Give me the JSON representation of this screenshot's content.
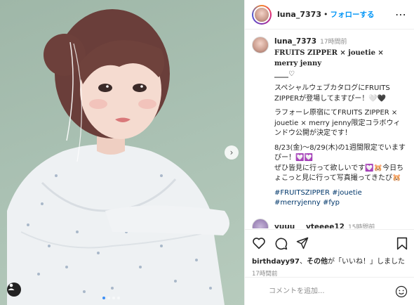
{
  "header": {
    "username": "luna_7373",
    "separator": "•",
    "follow_label": "フォローする",
    "more_label": "⋯"
  },
  "caption": {
    "username": "luna_7373",
    "time": "17時間前",
    "title": "FRUITS ZIPPER × jouetie × merry jenny",
    "title_tail": "____♡",
    "para1": "スペシャルウェブカタログにFRUITS ZIPPERが登場してますぴー！🤍🖤",
    "para2": "ラフォーレ原宿にてFRUITS ZIPPER × jouetie × merry jenny限定コラボウィンドウ公開が決定です！",
    "para3": "8/23(金)〜8/29(木)の1週間限定でいますぴー！💟💟\nぜひ皆見に行って欲しいです💟🐹今日ちょこっと見に行って写真撮ってきたぴ🐹",
    "hashtags": "#FRUITSZIPPER #jouetie #merryjenny #fyp"
  },
  "reply": {
    "username": "yuuu___vteeee12",
    "time": "15時間前"
  },
  "likes": {
    "user": "birthdayy97",
    "mid": "、",
    "others": "その他",
    "rest": "が「いいね！」しました"
  },
  "post_time": "17時間前",
  "comment": {
    "placeholder": "コメントを追加..."
  },
  "carousel": {
    "slide_count": 4,
    "active_index": 1
  },
  "colors": {
    "link_blue": "#0095f6",
    "hashtag": "#00376b",
    "photo_bg": "#a9c0b2"
  }
}
